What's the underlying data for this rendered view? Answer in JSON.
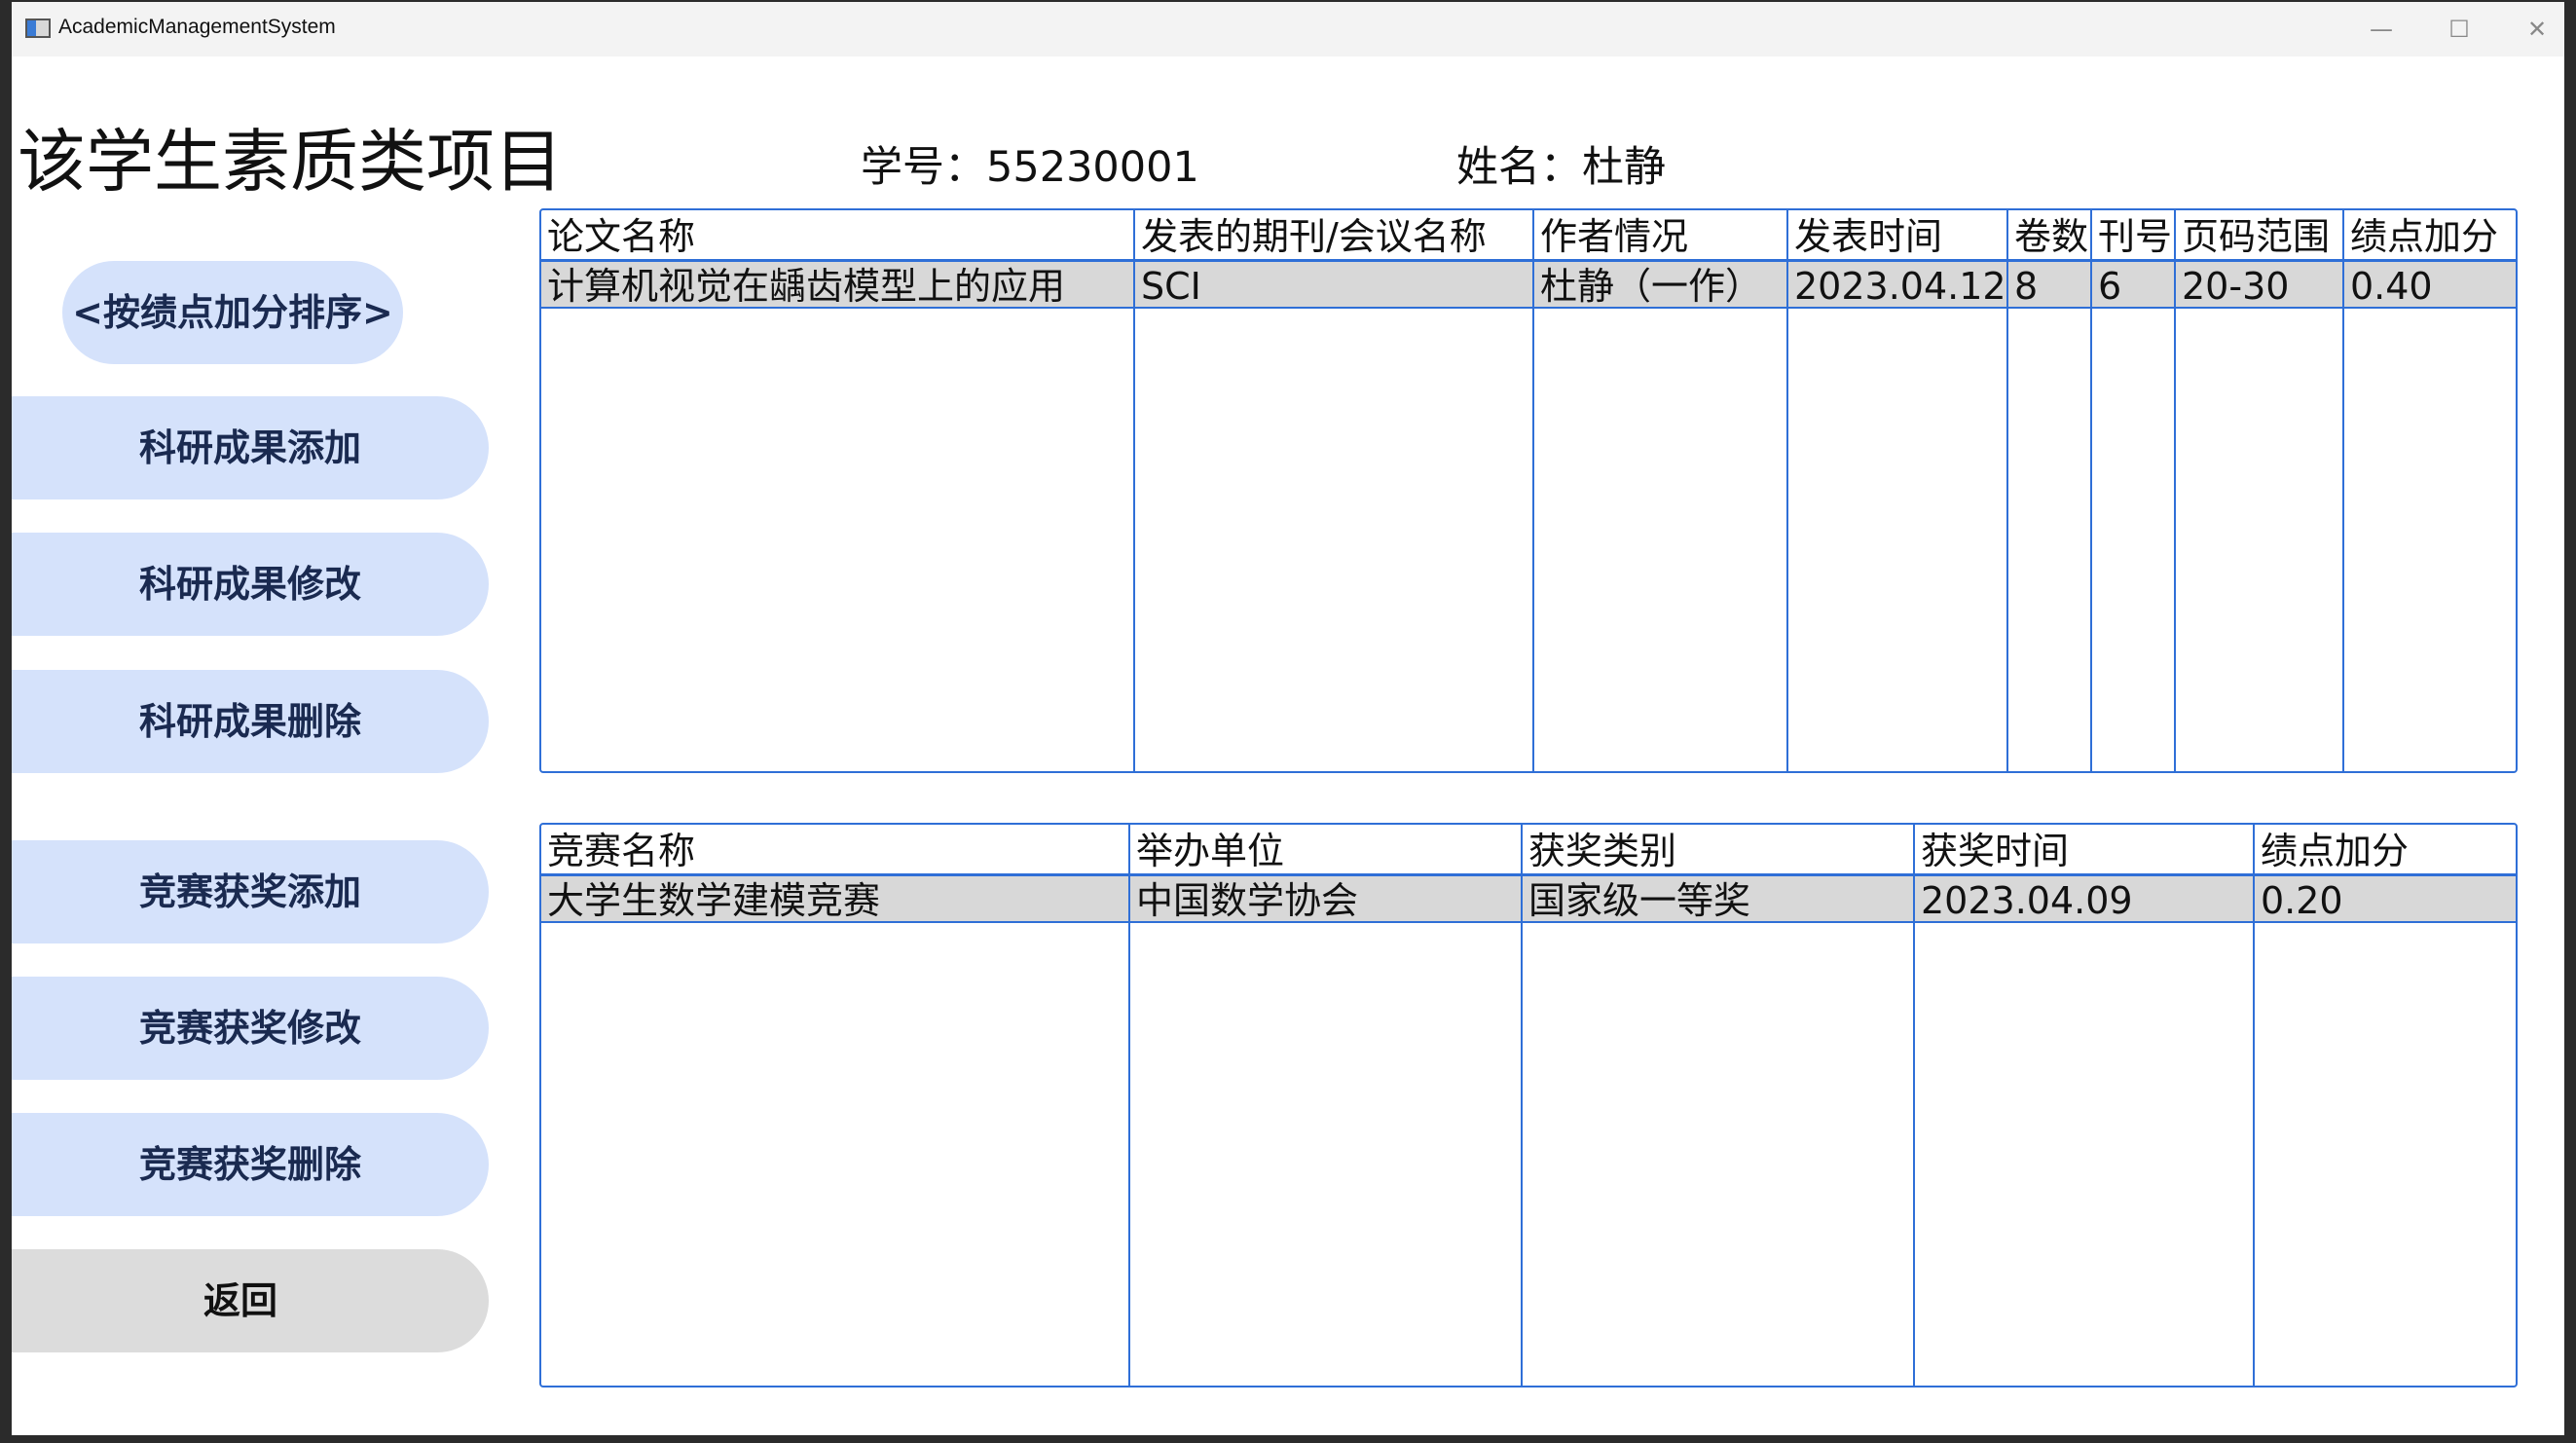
{
  "window": {
    "title": "AcademicManagementSystem",
    "minimize": "—",
    "maximize": "☐",
    "close": "✕"
  },
  "header": {
    "heading": "该学生素质类项目",
    "student_id": "学号：55230001",
    "student_name": "姓名：杜静"
  },
  "sidebar": {
    "sort_button": "<按绩点加分排序>",
    "research_add": "科研成果添加",
    "research_edit": "科研成果修改",
    "research_delete": "科研成果删除",
    "award_add": "竞赛获奖添加",
    "award_edit": "竞赛获奖修改",
    "award_delete": "竞赛获奖删除",
    "back": "返回"
  },
  "papers_table": {
    "columns": [
      "论文名称",
      "发表的期刊/会议名称",
      "作者情况",
      "发表时间",
      "卷数",
      "刊号",
      "页码范围",
      "绩点加分"
    ],
    "rows": [
      [
        "计算机视觉在龋齿模型上的应用",
        "SCI",
        "杜静（一作）",
        "2023.04.12",
        "8",
        "6",
        "20-30",
        "0.40"
      ]
    ]
  },
  "awards_table": {
    "columns": [
      "竞赛名称",
      "举办单位",
      "获奖类别",
      "获奖时间",
      "绩点加分"
    ],
    "rows": [
      [
        "大学生数学建模竞赛",
        "中国数学协会",
        "国家级一等奖",
        "2023.04.09",
        "0.20"
      ]
    ]
  },
  "colors": {
    "accent_border": "#2f6fd7",
    "button_bg": "#d5e2fb",
    "selected_row": "#d8d8d8"
  }
}
